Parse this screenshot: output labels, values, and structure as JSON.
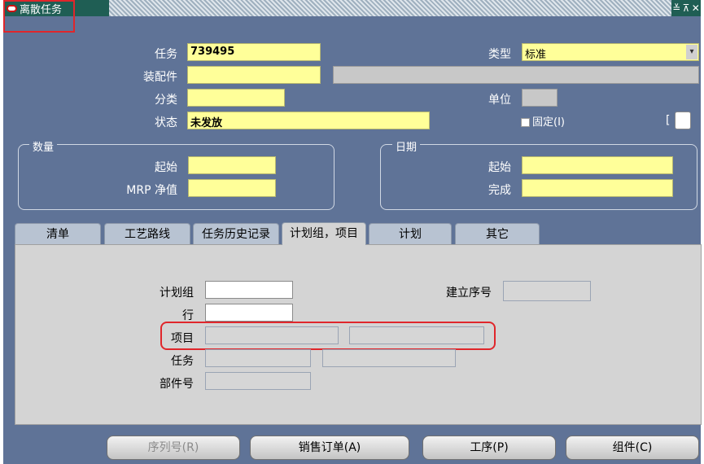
{
  "window": {
    "title": "离散任务",
    "controls": [
      "≚",
      "⊼",
      "✕"
    ]
  },
  "header": {
    "task_label": "任务",
    "task_value": "739495",
    "type_label": "类型",
    "type_value": "标准",
    "assembly_label": "装配件",
    "assembly_value": "",
    "assembly_desc": "",
    "class_label": "分类",
    "class_value": "",
    "uom_label": "单位",
    "uom_value": "",
    "status_label": "状态",
    "status_value": "未发放",
    "firm_label": "固定(I)",
    "bracket_left": "["
  },
  "quantity_group": {
    "title": "数量",
    "start_label": "起始",
    "start_value": "",
    "mrp_label": "MRP 净值",
    "mrp_value": ""
  },
  "date_group": {
    "title": "日期",
    "start_label": "起始",
    "start_value": "",
    "complete_label": "完成",
    "complete_value": ""
  },
  "tabs": [
    "清单",
    "工艺路线",
    "任务历史记录",
    "计划组，项目",
    "计划",
    "其它"
  ],
  "active_tab": "计划组，项目",
  "panel": {
    "plan_group_label": "计划组",
    "plan_group_value": "",
    "line_label": "行",
    "line_value": "",
    "project_label": "项目",
    "project_value": "",
    "project_desc": "",
    "task_label": "任务",
    "task_value": "",
    "task_desc": "",
    "part_label": "部件号",
    "part_value": "",
    "build_seq_label": "建立序号",
    "build_seq_value": ""
  },
  "buttons": {
    "serial": "序列号(R)",
    "sales_order": "销售订单(A)",
    "operations": "工序(P)",
    "components": "组件(C)"
  },
  "colors": {
    "highlight": "#e0262b",
    "required_field": "#ffff99",
    "form_bg": "#5f7397"
  }
}
